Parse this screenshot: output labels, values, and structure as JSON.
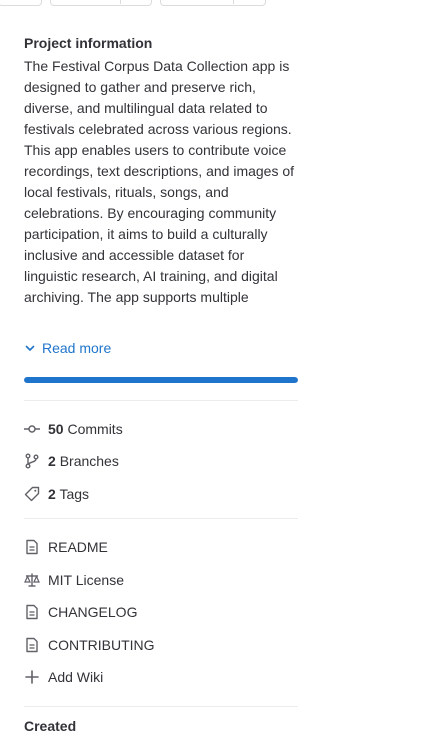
{
  "project": {
    "heading": "Project information",
    "description": "The Festival Corpus Data Collection app is designed to gather and preserve rich, diverse, and multilingual data related to festivals celebrated across various regions. This app enables users to contribute voice recordings, text descriptions, and images of local festivals, rituals, songs, and celebrations. By encouraging community participation, it aims to build a culturally inclusive and accessible dataset for linguistic research, AI training, and digital archiving. The app supports multiple",
    "read_more": "Read more",
    "progress_fraction": 1.0
  },
  "stats": {
    "commits_count": "50",
    "commits_label": "Commits",
    "branches_count": "2",
    "branches_label": "Branches",
    "tags_count": "2",
    "tags_label": "Tags"
  },
  "links": {
    "readme": "README",
    "license": "MIT License",
    "changelog": "CHANGELOG",
    "contributing": "CONTRIBUTING",
    "add_wiki": "Add Wiki"
  },
  "created_heading": "Created",
  "colors": {
    "accent": "#1f75cb",
    "text": "#333238",
    "icon": "#626168"
  }
}
